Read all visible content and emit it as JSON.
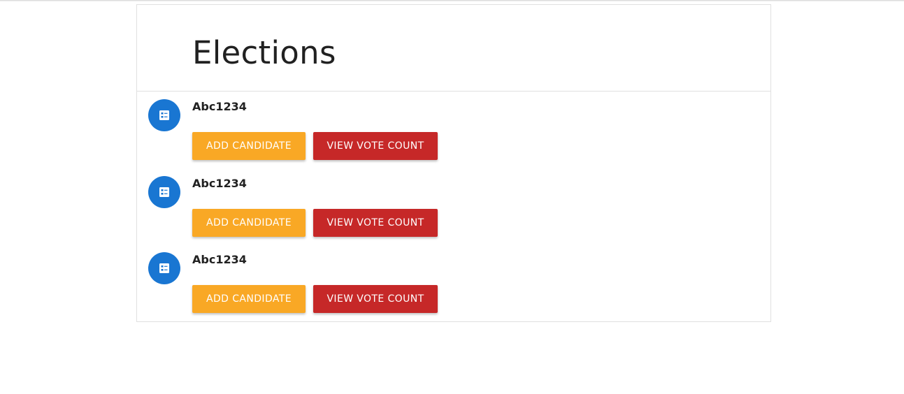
{
  "page": {
    "title": "Elections"
  },
  "colors": {
    "avatar": "#1976d2",
    "add_button": "#f9a825",
    "view_button": "#c62828"
  },
  "elections": [
    {
      "name": "Abc1234",
      "icon": "ballot-icon",
      "add_label": "ADD CANDIDATE",
      "view_label": "VIEW VOTE COUNT"
    },
    {
      "name": "Abc1234",
      "icon": "ballot-icon",
      "add_label": "ADD CANDIDATE",
      "view_label": "VIEW VOTE COUNT"
    },
    {
      "name": "Abc1234",
      "icon": "ballot-icon",
      "add_label": "ADD CANDIDATE",
      "view_label": "VIEW VOTE COUNT"
    }
  ]
}
